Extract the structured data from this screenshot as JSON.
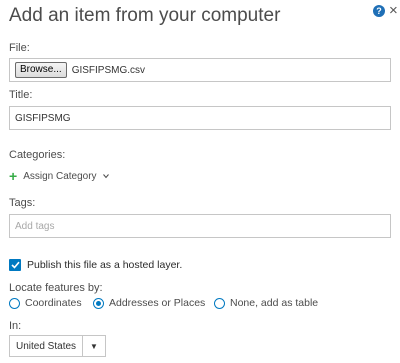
{
  "dialog": {
    "title": "Add an item from your computer",
    "help_glyph": "?",
    "close_glyph": "×"
  },
  "file": {
    "label": "File:",
    "browse_label": "Browse...",
    "file_name": "GISFIPSMG.csv"
  },
  "title_field": {
    "label": "Title:",
    "value": "GISFIPSMG"
  },
  "categories": {
    "label": "Categories:",
    "assign_label": "Assign Category"
  },
  "tags": {
    "label": "Tags:",
    "placeholder": "Add tags"
  },
  "publish": {
    "label": "Publish this file as a hosted layer.",
    "checked": true
  },
  "locate": {
    "label": "Locate features by:",
    "options": [
      {
        "label": "Coordinates",
        "selected": false
      },
      {
        "label": "Addresses or Places",
        "selected": true
      },
      {
        "label": "None, add as table",
        "selected": false
      }
    ]
  },
  "country": {
    "label": "In:",
    "value": "United States"
  },
  "colors": {
    "accent": "#0079c1",
    "add_green": "#35ac46",
    "help_blue": "#1f6fb6"
  }
}
